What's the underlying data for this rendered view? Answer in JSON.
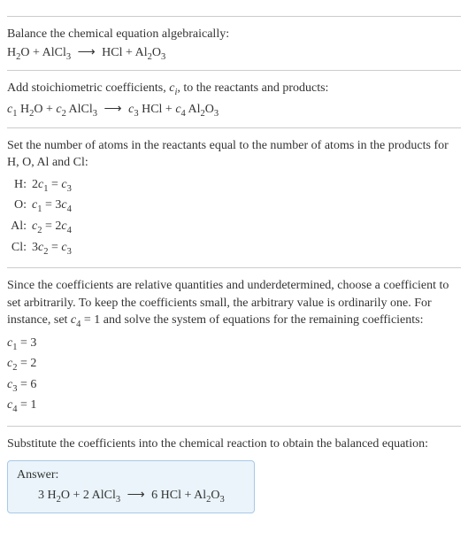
{
  "section1": {
    "title": "Balance the chemical equation algebraically:",
    "eq_lhs1": "H",
    "eq_lhs1_sub": "2",
    "eq_lhs2": "O + AlCl",
    "eq_lhs2_sub": "3",
    "arrow": "⟶",
    "eq_rhs1": "HCl + Al",
    "eq_rhs1_sub": "2",
    "eq_rhs2": "O",
    "eq_rhs2_sub": "3"
  },
  "section2": {
    "intro1": "Add stoichiometric coefficients, ",
    "ci": "c",
    "ci_sub": "i",
    "intro2": ", to the reactants and products:",
    "c1": "c",
    "s1": "1",
    "sp1": " H",
    "sp1_sub": "2",
    "sp2": "O + ",
    "c2": "c",
    "s2": "2",
    "sp3": " AlCl",
    "sp3_sub": "3",
    "arrow": "⟶",
    "c3": "c",
    "s3": "3",
    "sp4": " HCl + ",
    "c4": "c",
    "s4": "4",
    "sp5": " Al",
    "sp5_sub": "2",
    "sp6": "O",
    "sp6_sub": "3"
  },
  "section3": {
    "intro": "Set the number of atoms in the reactants equal to the number of atoms in the products for H, O, Al and Cl:",
    "rows": [
      {
        "label": "H:",
        "c1": "2",
        "v1": "c",
        "s1": "1",
        "eq": " = ",
        "v2": "c",
        "s2": "3"
      },
      {
        "label": "O:",
        "c1": "",
        "v1": "c",
        "s1": "1",
        "eq": " = 3",
        "v2": "c",
        "s2": "4"
      },
      {
        "label": "Al:",
        "c1": "",
        "v1": "c",
        "s1": "2",
        "eq": " = 2",
        "v2": "c",
        "s2": "4"
      },
      {
        "label": "Cl:",
        "c1": "3",
        "v1": "c",
        "s1": "2",
        "eq": " = ",
        "v2": "c",
        "s2": "3"
      }
    ]
  },
  "section4": {
    "intro1": "Since the coefficients are relative quantities and underdetermined, choose a coefficient to set arbitrarily. To keep the coefficients small, the arbitrary value is ordinarily one. For instance, set ",
    "cvar": "c",
    "csub": "4",
    "intro2": " = 1 and solve the system of equations for the remaining coefficients:",
    "coefs": [
      {
        "c": "c",
        "sub": "1",
        "val": " = 3"
      },
      {
        "c": "c",
        "sub": "2",
        "val": " = 2"
      },
      {
        "c": "c",
        "sub": "3",
        "val": " = 6"
      },
      {
        "c": "c",
        "sub": "4",
        "val": " = 1"
      }
    ]
  },
  "section5": {
    "intro": "Substitute the coefficients into the chemical reaction to obtain the balanced equation:",
    "answer_label": "Answer:",
    "eq_c1": "3 H",
    "eq_c1_sub": "2",
    "eq_c2": "O + 2 AlCl",
    "eq_c2_sub": "3",
    "arrow": "⟶",
    "eq_c3": "6 HCl + Al",
    "eq_c3_sub": "2",
    "eq_c4": "O",
    "eq_c4_sub": "3"
  }
}
